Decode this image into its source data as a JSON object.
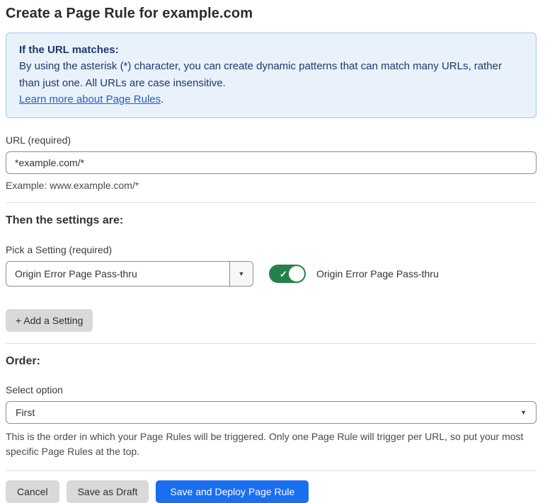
{
  "page": {
    "title": "Create a Page Rule for example.com"
  },
  "info_box": {
    "heading": "If the URL matches:",
    "body": "By using the asterisk (*) character, you can create dynamic patterns that can match many URLs, rather than just one. All URLs are case insensitive.",
    "link_label": "Learn more about Page Rules",
    "link_suffix": "."
  },
  "url_field": {
    "label": "URL (required)",
    "value": "*example.com/*",
    "hint": "Example: www.example.com/*"
  },
  "settings_section": {
    "heading": "Then the settings are:",
    "picker_label": "Pick a Setting (required)",
    "picker_value": "Origin Error Page Pass-thru",
    "toggle_state": "on",
    "toggle_label": "Origin Error Page Pass-thru",
    "add_setting_label": "+ Add a Setting"
  },
  "order_section": {
    "heading": "Order:",
    "select_label": "Select option",
    "select_value": "First",
    "help_text": "This is the order in which your Page Rules will be triggered. Only one Page Rule will trigger per URL, so put your most specific Page Rules at the top."
  },
  "actions": {
    "cancel_label": "Cancel",
    "save_draft_label": "Save as Draft",
    "save_deploy_label": "Save and Deploy Page Rule"
  },
  "icons": {
    "dropdown_arrow": "▼",
    "toggle_check": "✓"
  },
  "colors": {
    "primary_blue": "#1a6ef0",
    "toggle_green": "#26804a",
    "info_bg": "#e9f1fb",
    "info_border": "#a9c7e4",
    "info_text": "#1b3a6b",
    "link_blue": "#2161c4",
    "button_grey": "#d9d9d9"
  }
}
